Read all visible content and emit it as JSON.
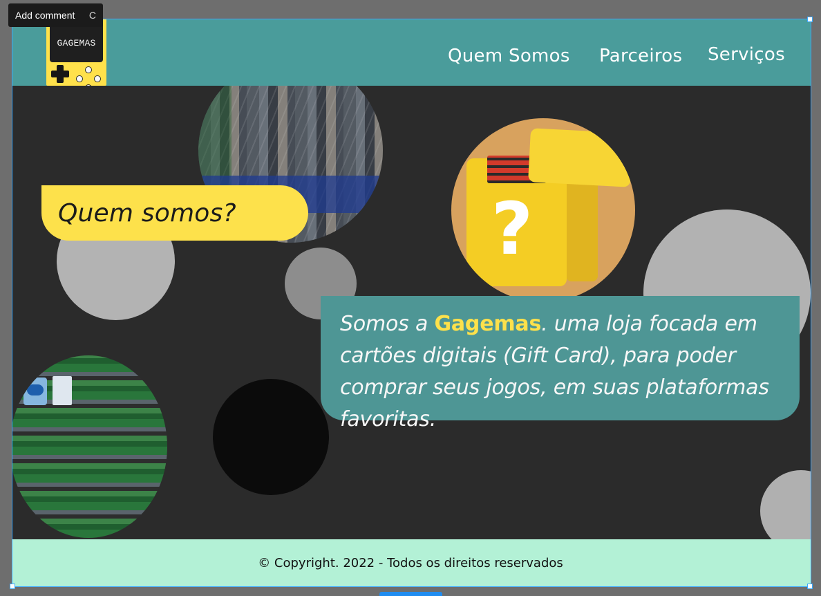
{
  "tooltip": {
    "label": "Add comment",
    "shortcut": "C"
  },
  "brand": {
    "logo_text": "GAGEMAS"
  },
  "nav": {
    "items": [
      {
        "label": "Quem Somos"
      },
      {
        "label": "Parceiros"
      },
      {
        "label": "Serviços"
      }
    ]
  },
  "about": {
    "title": "Quem somos?",
    "intro_prefix": "Somos a ",
    "brand_name": "Gagemas",
    "intro_suffix": ". uma loja focada em cartões digitais (Gift Card), para poder comprar seus jogos, em suas plataformas favoritas."
  },
  "footer": {
    "copyright": "© Copyright. 2022 - Todos os direitos reservados"
  },
  "colors": {
    "header": "#4a9c9b",
    "page_bg": "#2b2b2b",
    "accent_yellow": "#fde14b",
    "card": "#4e9695",
    "footer_bg": "#b3f1d6",
    "selection": "#3ba8ff"
  }
}
